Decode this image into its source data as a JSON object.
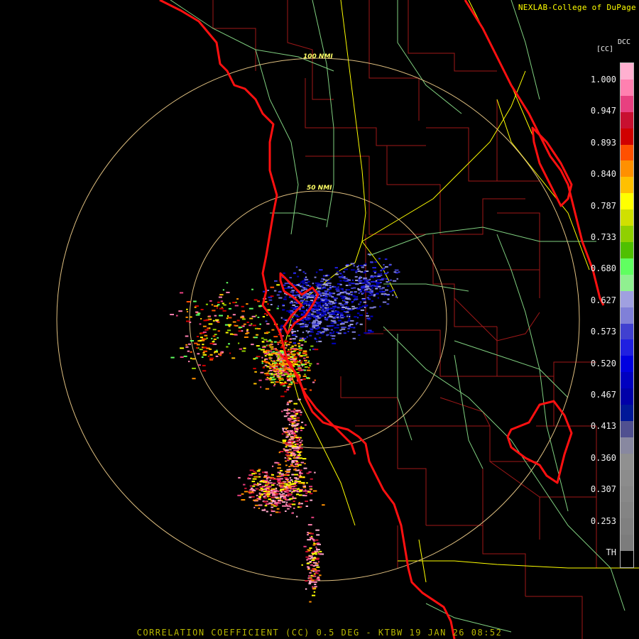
{
  "header": {
    "credit": "NEXLAB-College of DuPage"
  },
  "footer": {
    "title": "CORRELATION COEFFICIENT (CC) 0.5 DEG - KTBW 19 JAN 26 08:52"
  },
  "colorbar": {
    "product": "DCC",
    "unit": "[CC]",
    "labels": [
      "1.000",
      "0.947",
      "0.893",
      "0.840",
      "0.787",
      "0.733",
      "0.680",
      "0.627",
      "0.573",
      "0.520",
      "0.467",
      "0.413",
      "0.360",
      "0.307",
      "0.253",
      "TH"
    ],
    "colors": [
      "#ffb0d0",
      "#ff80b0",
      "#e84080",
      "#c81030",
      "#d00000",
      "#ff5000",
      "#ff9000",
      "#ffc000",
      "#ffff00",
      "#d0e000",
      "#90d000",
      "#50c000",
      "#60ff60",
      "#90f090",
      "#a0a0e0",
      "#8080d8",
      "#4040d0",
      "#2020e0",
      "#0000e0",
      "#0000c0",
      "#0000a8",
      "#001898",
      "#505090",
      "#8888a0",
      "#909090",
      "#8c8c8c",
      "#888888",
      "#848484",
      "#808080",
      "#7c7c7c",
      "#000000"
    ]
  },
  "map": {
    "range_rings": [
      {
        "label": "50 NMI"
      },
      {
        "label": "100 NMI"
      }
    ],
    "colors": {
      "coastline": "#ff1010",
      "county_lines": "#a01818",
      "highways": "#ffff00",
      "roads": "#80d080",
      "range_ring": "#e0c080"
    }
  }
}
